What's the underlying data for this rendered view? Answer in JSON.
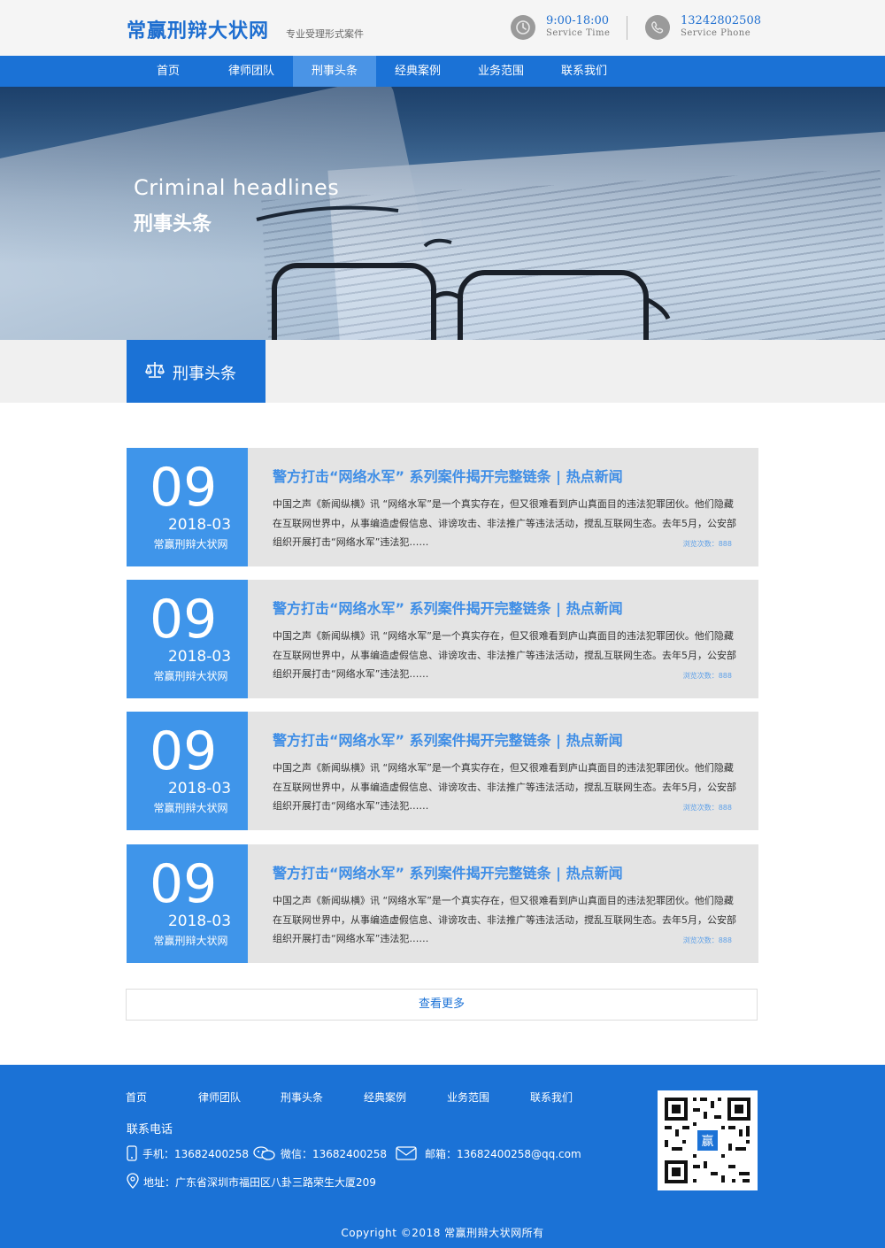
{
  "header": {
    "logo": "常赢刑辩大状网",
    "slogan": "专业受理形式案件",
    "service_time": "9:00-18:00",
    "service_time_label": "Service Time",
    "service_phone": "13242802508",
    "service_phone_label": "Service Phone"
  },
  "nav": {
    "items": [
      "首页",
      "律师团队",
      "刑事头条",
      "经典案例",
      "业务范围",
      "联系我们"
    ],
    "active_index": 2
  },
  "banner": {
    "title_en": "Criminal headlines",
    "title_cn": "刑事头条"
  },
  "section": {
    "title": "刑事头条"
  },
  "news": [
    {
      "day": "09",
      "year_month": "2018-03",
      "source": "常赢刑辩大状网",
      "title": "警方打击“网络水军” 系列案件揭开完整链条 | 热点新闻",
      "summary": "中国之声《新闻纵横》讯 “网络水军”是一个真实存在，但又很难看到庐山真面目的违法犯罪团伙。他们隐藏在互联网世界中，从事编造虚假信息、诽谤攻击、非法推广等违法活动，搅乱互联网生态。去年5月，公安部组织开展打击“网络水军”违法犯……",
      "views": "浏览次数：888"
    },
    {
      "day": "09",
      "year_month": "2018-03",
      "source": "常赢刑辩大状网",
      "title": "警方打击“网络水军” 系列案件揭开完整链条 | 热点新闻",
      "summary": "中国之声《新闻纵横》讯 “网络水军”是一个真实存在，但又很难看到庐山真面目的违法犯罪团伙。他们隐藏在互联网世界中，从事编造虚假信息、诽谤攻击、非法推广等违法活动，搅乱互联网生态。去年5月，公安部组织开展打击“网络水军”违法犯……",
      "views": "浏览次数：888"
    },
    {
      "day": "09",
      "year_month": "2018-03",
      "source": "常赢刑辩大状网",
      "title": "警方打击“网络水军” 系列案件揭开完整链条 | 热点新闻",
      "summary": "中国之声《新闻纵横》讯 “网络水军”是一个真实存在，但又很难看到庐山真面目的违法犯罪团伙。他们隐藏在互联网世界中，从事编造虚假信息、诽谤攻击、非法推广等违法活动，搅乱互联网生态。去年5月，公安部组织开展打击“网络水军”违法犯……",
      "views": "浏览次数：888"
    },
    {
      "day": "09",
      "year_month": "2018-03",
      "source": "常赢刑辩大状网",
      "title": "警方打击“网络水军” 系列案件揭开完整链条 | 热点新闻",
      "summary": "中国之声《新闻纵横》讯 “网络水军”是一个真实存在，但又很难看到庐山真面目的违法犯罪团伙。他们隐藏在互联网世界中，从事编造虚假信息、诽谤攻击、非法推广等违法活动，搅乱互联网生态。去年5月，公安部组织开展打击“网络水军”违法犯……",
      "views": "浏览次数：888"
    }
  ],
  "more_label": "查看更多",
  "footer": {
    "nav": [
      "首页",
      "律师团队",
      "刑事头条",
      "经典案例",
      "业务范围",
      "联系我们"
    ],
    "contact_heading": "联系电话",
    "mobile": "手机：13682400258",
    "wechat": "微信：13682400258",
    "email": "邮箱：13682400258@qq.com",
    "address": "地址：广东省深圳市福田区八卦三路荣生大厦209",
    "qr_center_char": "赢",
    "copyright": "Copyright ©2018  常赢刑辩大状网所有"
  },
  "colors": {
    "brand_blue": "#1b72d6",
    "date_blue": "#3f95ea",
    "card_gray": "#e4e4e4"
  }
}
